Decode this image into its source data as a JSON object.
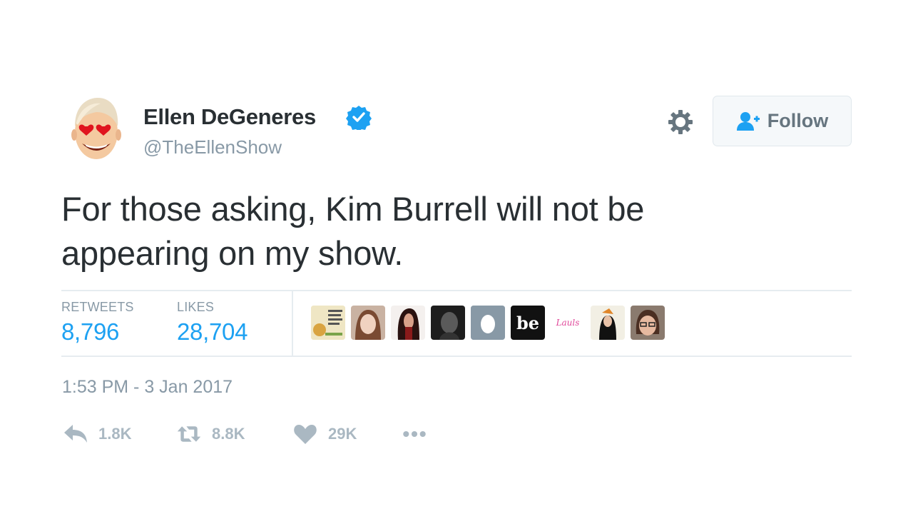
{
  "user": {
    "name": "Ellen DeGeneres",
    "handle": "@TheEllenShow",
    "verified": true
  },
  "follow_button": {
    "label": "Follow",
    "icon": "follow-user-icon"
  },
  "settings_icon": "gear-icon",
  "tweet": {
    "line1": "For those asking, Kim Burrell will not be",
    "line2": "appearing on my show."
  },
  "stats": {
    "retweets_label": "RETWEETS",
    "retweets_value": "8,796",
    "likes_label": "LIKES",
    "likes_value": "28,704"
  },
  "likers": [
    {
      "name": "liker-1"
    },
    {
      "name": "liker-2"
    },
    {
      "name": "liker-3"
    },
    {
      "name": "liker-4"
    },
    {
      "name": "liker-5"
    },
    {
      "name": "liker-6",
      "text": "be"
    },
    {
      "name": "liker-7",
      "text": "Lauls"
    },
    {
      "name": "liker-8"
    },
    {
      "name": "liker-9"
    }
  ],
  "timestamp": "1:53 PM - 3 Jan 2017",
  "actions": {
    "reply_count": "1.8K",
    "retweet_count": "8.8K",
    "like_count": "29K"
  },
  "colors": {
    "accent": "#1da1f2",
    "muted": "#8899a6",
    "action_gray": "#aab8c2"
  }
}
